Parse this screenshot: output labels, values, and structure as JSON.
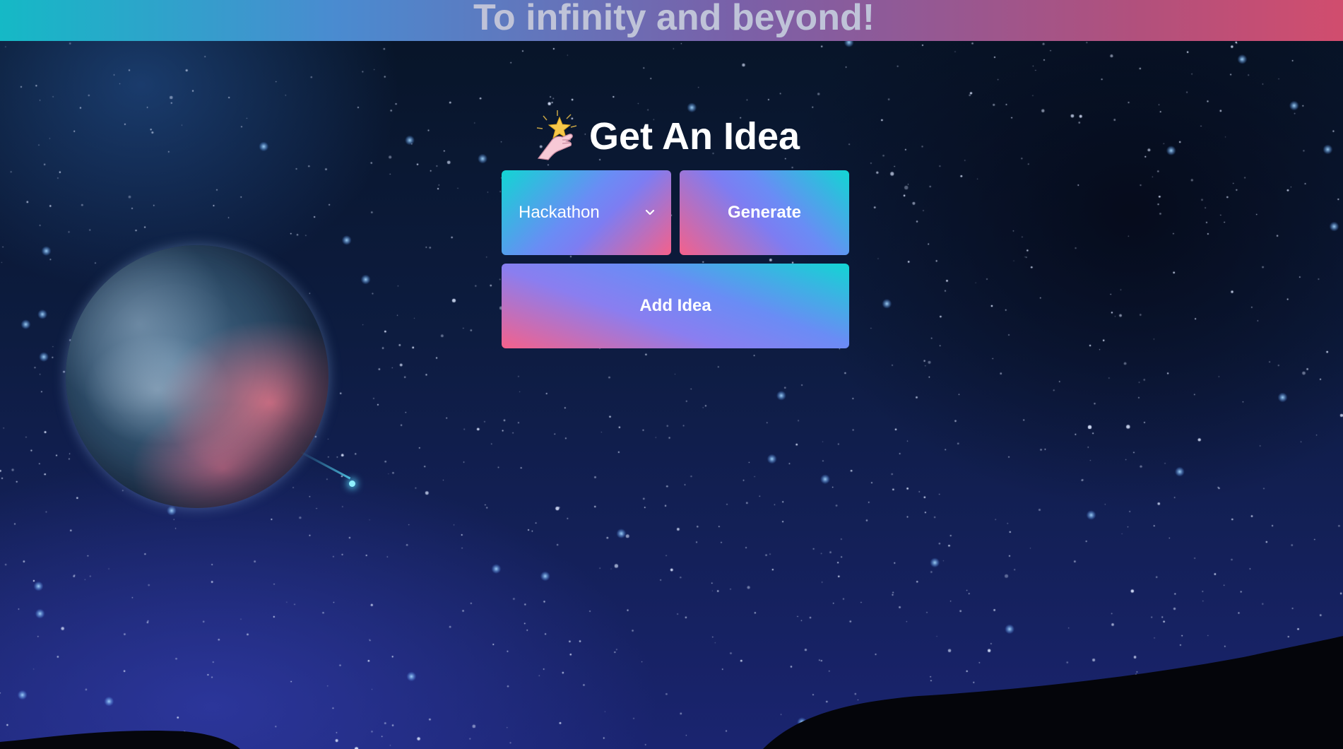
{
  "banner": {
    "title": "To infinity and beyond!"
  },
  "main": {
    "heading": "Get An Idea",
    "heading_icon": "star-in-hand-icon",
    "category_select": {
      "selected": "Hackathon"
    },
    "generate_label": "Generate",
    "add_idea_label": "Add Idea"
  },
  "colors": {
    "banner_start": "#15b9c6",
    "banner_end": "#d14d6e",
    "gradient_teal": "#12d5d3",
    "gradient_blue": "#6a8cf5",
    "gradient_pink": "#f4618b"
  }
}
